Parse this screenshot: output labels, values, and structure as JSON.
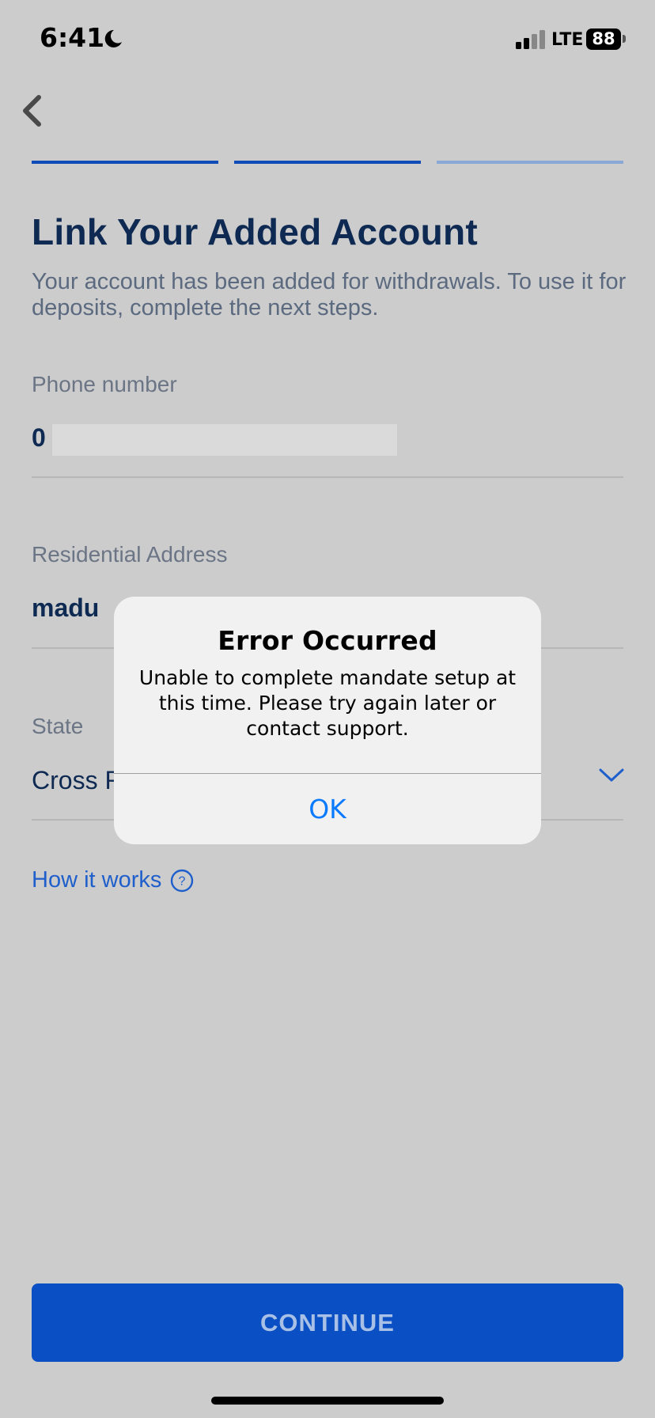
{
  "status_bar": {
    "time": "6:41",
    "network": "LTE",
    "battery": "88"
  },
  "progress": {
    "total_steps": 3,
    "completed_steps": 2
  },
  "header": {
    "title": "Link Your Added Account",
    "subtitle": "Your account has been added for withdrawals. To use it for deposits, complete the next steps."
  },
  "form": {
    "phone": {
      "label": "Phone number",
      "value": "0"
    },
    "address": {
      "label": "Residential Address",
      "value": "madu"
    },
    "state": {
      "label": "State",
      "value": "Cross R"
    }
  },
  "help": {
    "label": "How it works"
  },
  "footer": {
    "continue_label": "CONTINUE"
  },
  "alert": {
    "title": "Error Occurred",
    "message": "Unable to complete mandate setup at this time. Please try again later or contact support.",
    "ok_label": "OK"
  },
  "colors": {
    "background": "#cccccc",
    "primary": "#0a4fc4",
    "title": "#0e2a52",
    "link": "#1f5fcc",
    "alert_button": "#0a7aff"
  }
}
